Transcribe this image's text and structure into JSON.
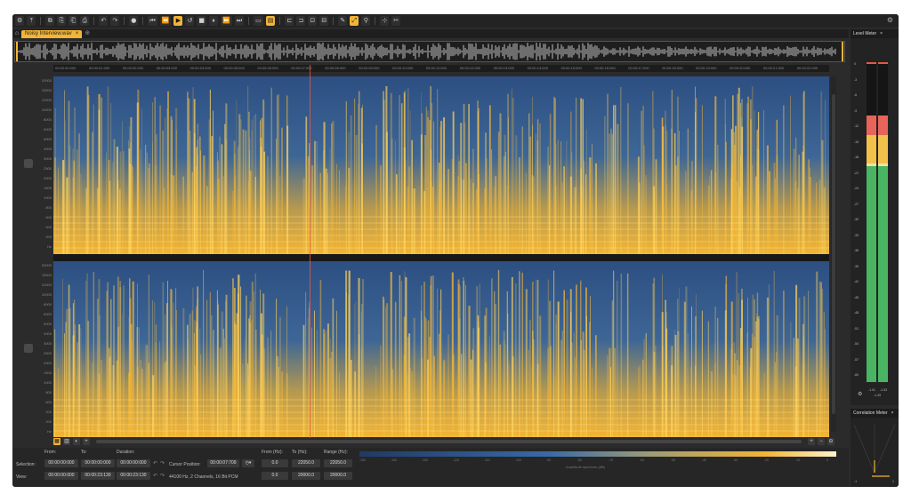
{
  "toolbar": {
    "buttons": [
      "⚙",
      "⤒",
      "⧉",
      "⎘",
      "⎗",
      "⎙",
      "↶",
      "↷",
      "●",
      "⏮",
      "⏪",
      "▶",
      "↺",
      "■",
      "⏸",
      "⏩",
      "⏭",
      "▭",
      "▤",
      "⊏",
      "⊐",
      "⊡",
      "⊟",
      "✎",
      "⤢",
      "⚲",
      "⊹",
      "✂"
    ],
    "active_indices": [
      11,
      18,
      24
    ]
  },
  "tab": {
    "filename": "Noisy Interview.wav",
    "close": "×"
  },
  "ruler": {
    "labels": [
      "00:00:00:000",
      "00:00:01:000",
      "00:00:02:000",
      "00:00:03:000",
      "00:00:04:000",
      "00:00:05:000",
      "00:00:06:000",
      "00:00:07:000",
      "00:00:08:000",
      "00:00:09:000",
      "00:00:10:000",
      "00:00:11:000",
      "00:00:12:000",
      "00:00:13:000",
      "00:00:14:000",
      "00:00:15:000",
      "00:00:16:000",
      "00:00:17:000",
      "00:00:18:000",
      "00:00:19:000",
      "00:00:20:000",
      "00:00:21:000",
      "00:00:22:000"
    ]
  },
  "freq_labels": [
    "20000",
    "15000",
    "12000",
    "10000",
    "8000",
    "6000",
    "5000",
    "4000",
    "3000",
    "2500",
    "2000",
    "1500",
    "1000",
    "800",
    "600",
    "400",
    "200",
    "Hz"
  ],
  "status": {
    "from_label": "From:",
    "to_label": "To:",
    "duration_label": "Duration:",
    "selection_label": "Selection:",
    "view_label": "View:",
    "sel_from": "00:00:00:000",
    "sel_to": "00:00:00:000",
    "sel_dur": "00:00:00:000",
    "view_from": "00:00:00:000",
    "view_to": "00:00:23:130",
    "view_dur": "00:00:23:130",
    "cursor_label": "Cursor Position:",
    "cursor_value": "00:00:07:709",
    "format": "44100 Hz, 2 Channels, 16 Bit PCM",
    "from_hz_label": "From (Hz):",
    "to_hz_label": "To (Hz):",
    "range_hz_label": "Range (Hz):",
    "sel_from_hz": "0.0",
    "sel_to_hz": "22050.0",
    "sel_range_hz": "22050.0",
    "view_from_hz": "0.0",
    "view_to_hz": "20000.0",
    "view_range_hz": "20000.0"
  },
  "colorbar": {
    "ticks": [
      "-150",
      "-140",
      "-130",
      "-120",
      "-110",
      "-100",
      "-90",
      "-80",
      "-70",
      "-60",
      "-50",
      "-40",
      "-30",
      "-20",
      "-10",
      "0"
    ],
    "label": "Amplitude spectrum (dB)"
  },
  "level_meter": {
    "title": "Level Meter",
    "close": "×",
    "scale": [
      "0",
      "-3",
      "-6",
      "-9",
      "-12",
      "-15",
      "-18",
      "-21",
      "-24",
      "-27",
      "-30",
      "-33",
      "-36",
      "-39",
      "-42",
      "-45",
      "-48",
      "-51",
      "-54",
      "-57",
      "-60"
    ],
    "peak_left": "-1.01",
    "peak_right": "-1.03",
    "peak_sub": "-1.43"
  },
  "correlation_meter": {
    "title": "Correlation Meter",
    "close": "×",
    "min": "-1",
    "max": "1"
  },
  "colors": {
    "accent": "#f2b535",
    "spectrum_low": "#2d4f82",
    "spectrum_high": "#ffd25a"
  }
}
